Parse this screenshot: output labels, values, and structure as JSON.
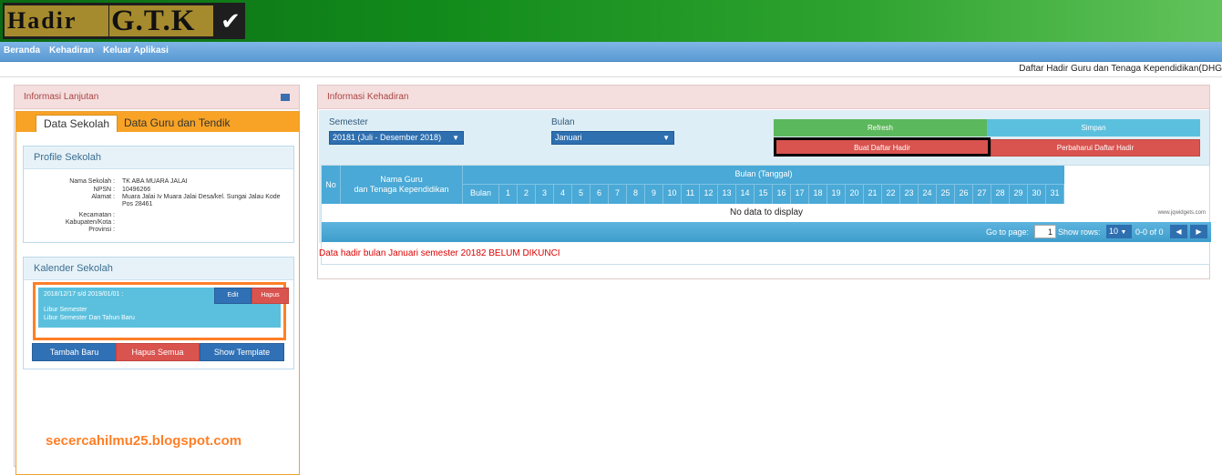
{
  "logo": {
    "part1": "Hadir",
    "part2": "G.T.K"
  },
  "nav": {
    "items": [
      "Beranda",
      "Kehadiran",
      "Keluar Aplikasi"
    ]
  },
  "breadcrumb": "Daftar Hadir Guru dan Tenaga Kependidikan(DHG",
  "left_panel": {
    "title": "Informasi Lanjutan",
    "tabs": [
      "Data Sekolah",
      "Data Guru dan Tendik"
    ],
    "profile": {
      "title": "Profile Sekolah",
      "rows": [
        {
          "k": "Nama Sekolah :",
          "v": "TK ABA MUARA JALAI"
        },
        {
          "k": "NPSN :",
          "v": "10496266"
        },
        {
          "k": "Alamat :",
          "v": "Muara Jalai Iv Muara Jalai Desa/kel. Sungai Jalau Kode Pos 28461"
        },
        {
          "k": "Kecamatan :",
          "v": ""
        },
        {
          "k": "Kabupaten/Kota :",
          "v": ""
        },
        {
          "k": "Provinsi :",
          "v": ""
        }
      ]
    },
    "kalender": {
      "title": "Kalender Sekolah",
      "event_date": "2018/12/17 s/d 2019/01/01 :",
      "event_line1": "Libur Semester",
      "event_line2": "Libur Semester Dan Tahun Baru",
      "edit": "Edit",
      "hapus": "Hapus",
      "tambah": "Tambah Baru",
      "hapus_semua": "Hapus Semua",
      "show_template": "Show Template"
    },
    "blog": "secercahilmu25.blogspot.com"
  },
  "right_panel": {
    "title": "Informasi Kehadiran",
    "semester_label": "Semester",
    "semester_value": "20181 (Juli - Desember 2018)",
    "bulan_label": "Bulan",
    "bulan_value": "Januari",
    "btn_refresh": "Refresh",
    "btn_simpan": "Simpan",
    "btn_buat": "Buat Daftar Hadir",
    "btn_perbaharui": "Perbaharui Daftar Hadir",
    "grid": {
      "col_no": "No",
      "col_nama_1": "Nama Guru",
      "col_nama_2": "dan Tenaga Kependidikan",
      "col_group": "Bulan (Tanggal)",
      "col_bulan": "Bulan",
      "days": [
        "1",
        "2",
        "3",
        "4",
        "5",
        "6",
        "7",
        "8",
        "9",
        "10",
        "11",
        "12",
        "13",
        "14",
        "15",
        "16",
        "17",
        "18",
        "19",
        "20",
        "21",
        "22",
        "23",
        "24",
        "25",
        "26",
        "27",
        "28",
        "29",
        "30",
        "31"
      ],
      "no_data": "No data to display",
      "watermark": "www.jqwidgets.com",
      "goto_label": "Go to page:",
      "page_value": "1",
      "show_rows_label": "Show rows:",
      "rows_value": "10",
      "range": "0-0 of 0"
    },
    "warning": "Data hadir bulan Januari semester 20182 BELUM DIKUNCI"
  }
}
